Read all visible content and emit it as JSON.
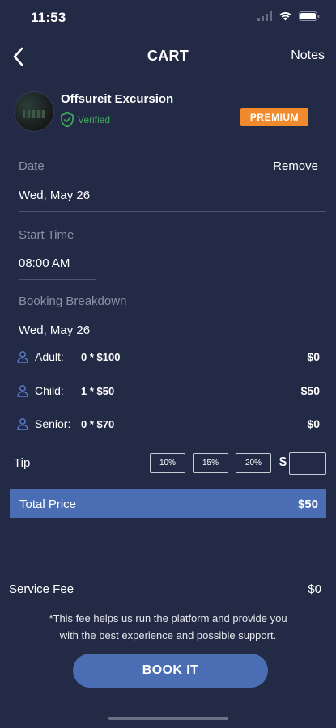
{
  "status_bar": {
    "time": "11:53"
  },
  "nav": {
    "title": "CART",
    "notes_label": "Notes"
  },
  "vendor": {
    "name": "Offsureit Excursion",
    "verified_label": "Verified",
    "badge": "PREMIUM"
  },
  "date": {
    "label": "Date",
    "remove_label": "Remove",
    "value": "Wed, May 26"
  },
  "start_time": {
    "label": "Start Time",
    "value": "08:00 AM"
  },
  "breakdown": {
    "label": "Booking Breakdown",
    "date": "Wed, May 26",
    "rows": [
      {
        "type": "Adult:",
        "calc": "0 * $100",
        "total": "$0"
      },
      {
        "type": "Child:",
        "calc": "1 * $50",
        "total": "$50"
      },
      {
        "type": "Senior:",
        "calc": "0 * $70",
        "total": "$0"
      }
    ]
  },
  "tip": {
    "label": "Tip",
    "options": [
      "10%",
      "15%",
      "20%"
    ],
    "currency_symbol": "$",
    "custom_value": ""
  },
  "total": {
    "label": "Total Price",
    "value": "$50"
  },
  "service_fee": {
    "label": "Service Fee",
    "value": "$0",
    "note_line1": "*This fee helps us run the platform and provide you",
    "note_line2": "with the best experience and possible support."
  },
  "book_button": {
    "label": "BOOK IT"
  },
  "colors": {
    "background": "#222a45",
    "accent_blue": "#4b6db3",
    "premium_orange": "#f08a2c",
    "verified_green": "#3fae5a",
    "muted_text": "#8a90a6"
  },
  "icons": {
    "back": "chevron-left-icon",
    "verified": "shield-check-icon",
    "person": "person-icon",
    "signal": "signal-icon",
    "wifi": "wifi-icon",
    "battery": "battery-icon"
  }
}
